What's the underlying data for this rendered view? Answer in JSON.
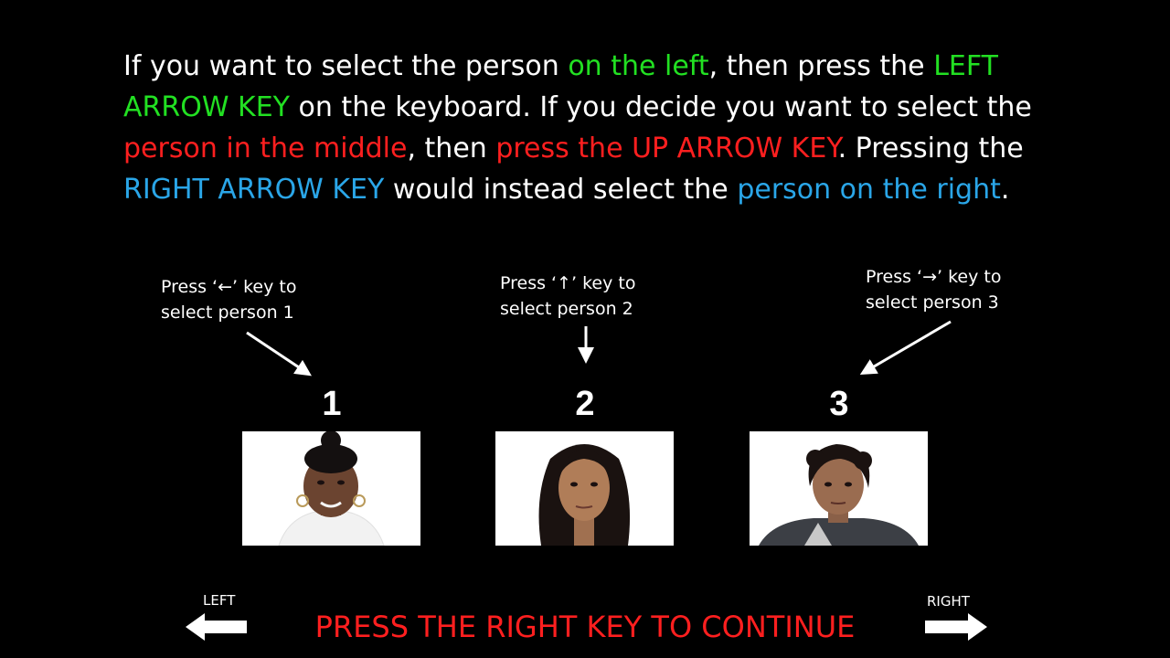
{
  "instructions": {
    "s1": "If you want to select the person ",
    "s2": "on the left",
    "s3": ", then press the ",
    "s4": "LEFT ARROW KEY",
    "s5": " on the keyboard. If you decide you want to select the ",
    "s6": "person in the middle",
    "s7": ", then ",
    "s8": "press the UP ARROW KEY",
    "s9": ". Pressing the ",
    "s10": "RIGHT ARROW KEY",
    "s11": " would instead select the ",
    "s12": "person on the right",
    "s13": "."
  },
  "hints": [
    {
      "line1": "Press ‘←’ key to",
      "line2": "select person 1"
    },
    {
      "line1": "Press ‘↑’ key to",
      "line2": "select person 2"
    },
    {
      "line1": "Press ‘→’ key to",
      "line2": "select person 3"
    }
  ],
  "people": [
    {
      "number": "1"
    },
    {
      "number": "2"
    },
    {
      "number": "3"
    }
  ],
  "nav": {
    "left_label": "LEFT",
    "right_label": "RIGHT",
    "continue_text": "PRESS THE RIGHT KEY TO CONTINUE"
  },
  "colors": {
    "background": "#000000",
    "green": "#22e022",
    "red": "#ff1f1f",
    "blue": "#2aa6e8"
  }
}
